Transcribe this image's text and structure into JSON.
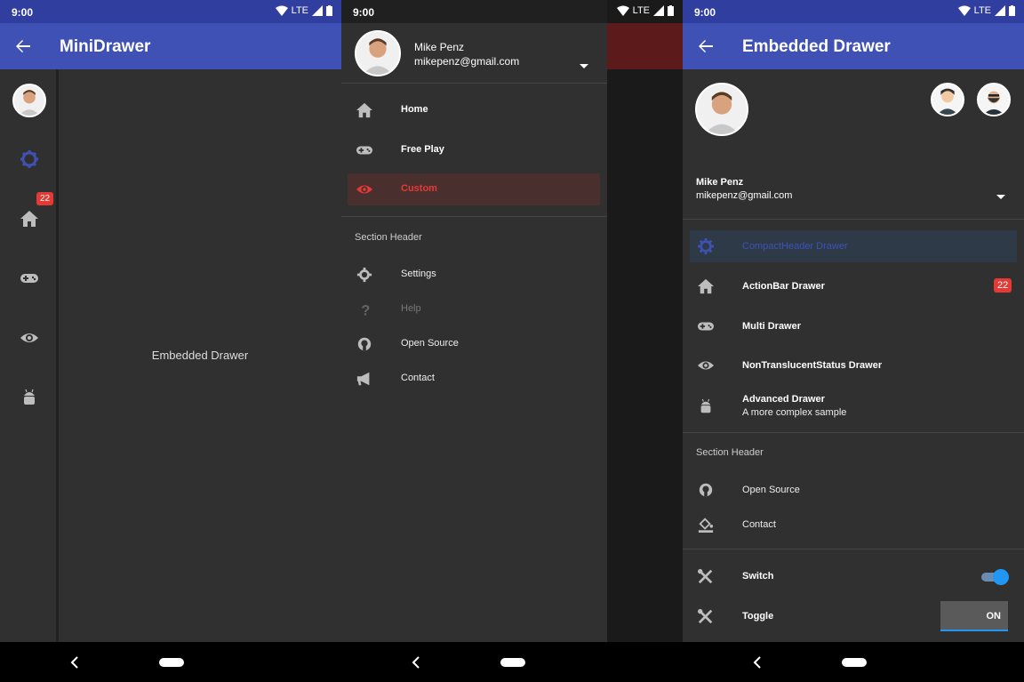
{
  "status": {
    "time": "9:00",
    "network": "LTE"
  },
  "screen1": {
    "title": "MiniDrawer",
    "badge": "22",
    "content_text": "Embedded Drawer"
  },
  "screen2": {
    "account": {
      "name": "Mike Penz",
      "email": "mikepenz@gmail.com"
    },
    "items": [
      "Home",
      "Free Play",
      "Custom"
    ],
    "section_header": "Section Header",
    "secondary": [
      "Settings",
      "Help",
      "Open Source",
      "Contact"
    ]
  },
  "screen3": {
    "title": "Embedded Drawer",
    "account": {
      "name": "Mike Penz",
      "email": "mikepenz@gmail.com"
    },
    "items": [
      {
        "label": "CompactHeader Drawer"
      },
      {
        "label": "ActionBar Drawer",
        "badge": "22"
      },
      {
        "label": "Multi Drawer"
      },
      {
        "label": "NonTranslucentStatus Drawer"
      },
      {
        "label": "Advanced Drawer",
        "sub": "A more complex sample"
      }
    ],
    "section_header": "Section Header",
    "secondary": [
      "Open Source",
      "Contact"
    ],
    "switch_label": "Switch",
    "toggle_label": "Toggle",
    "toggle_state": "ON"
  },
  "colors": {
    "primary": "#3f51b5",
    "accent": "#e53935",
    "switch": "#2196f3",
    "background": "#303030"
  }
}
